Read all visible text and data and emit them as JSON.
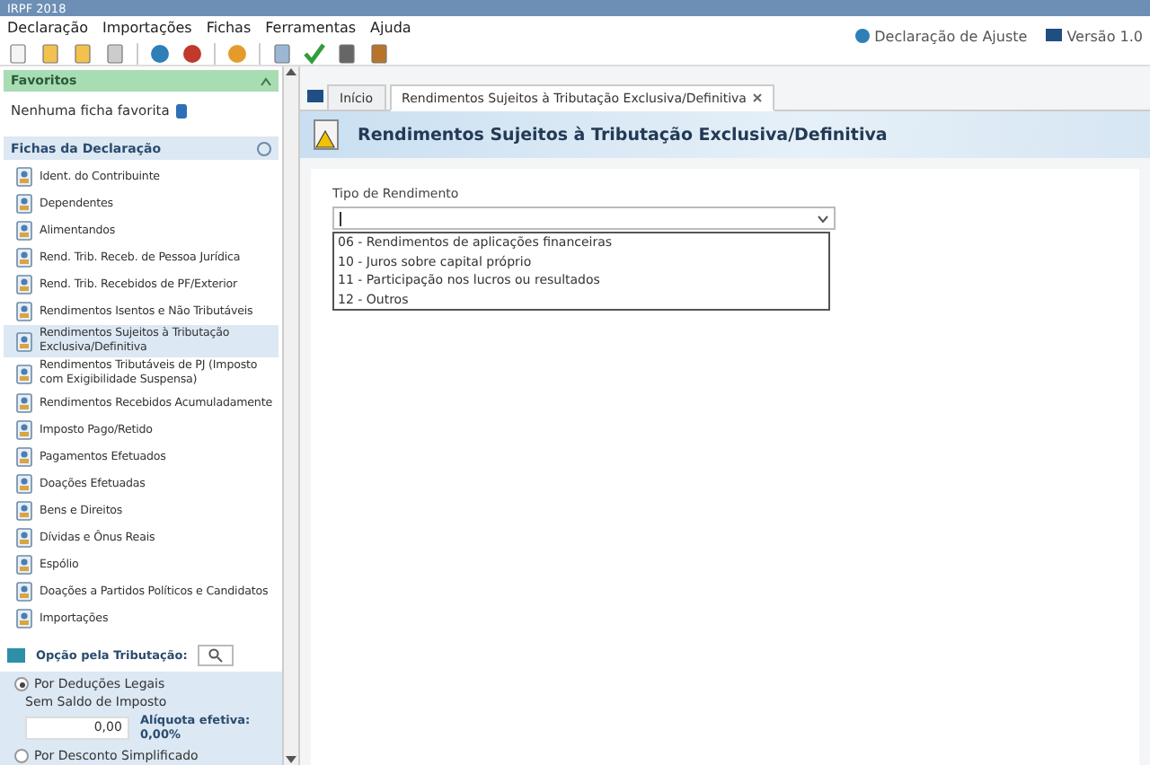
{
  "window": {
    "title": "IRPF 2018"
  },
  "menu": [
    "Declaração",
    "Importações",
    "Fichas",
    "Ferramentas",
    "Ajuda"
  ],
  "status": {
    "declaration": "Declaração de Ajuste",
    "version": "Versão 1.0"
  },
  "favorites": {
    "title": "Favoritos",
    "empty": "Nenhuma ficha favorita"
  },
  "sidebar": {
    "title": "Fichas da Declaração",
    "items": [
      {
        "label": "Ident. do Contribuinte",
        "selected": false
      },
      {
        "label": "Dependentes",
        "selected": false
      },
      {
        "label": "Alimentandos",
        "selected": false
      },
      {
        "label": "Rend. Trib. Receb. de Pessoa Jurídica",
        "selected": false
      },
      {
        "label": "Rend. Trib. Recebidos de PF/Exterior",
        "selected": false
      },
      {
        "label": "Rendimentos Isentos e Não Tributáveis",
        "selected": false
      },
      {
        "label": "Rendimentos Sujeitos à Tributação Exclusiva/Definitiva",
        "selected": true
      },
      {
        "label": "Rendimentos Tributáveis de PJ (Imposto com Exigibilidade Suspensa)",
        "selected": false
      },
      {
        "label": "Rendimentos Recebidos Acumuladamente",
        "selected": false
      },
      {
        "label": "Imposto Pago/Retido",
        "selected": false
      },
      {
        "label": "Pagamentos Efetuados",
        "selected": false
      },
      {
        "label": "Doações Efetuadas",
        "selected": false
      },
      {
        "label": "Bens e Direitos",
        "selected": false
      },
      {
        "label": "Dívidas e Ônus Reais",
        "selected": false
      },
      {
        "label": "Espólio",
        "selected": false
      },
      {
        "label": "Doações a Partidos Políticos e Candidatos",
        "selected": false
      },
      {
        "label": "Importações",
        "selected": false
      }
    ]
  },
  "taxation": {
    "title": "Opção pela Tributação:",
    "options": [
      {
        "label": "Por Deduções Legais",
        "selected": true,
        "balance_label": "Sem Saldo de Imposto",
        "value": "0,00",
        "rate": "Alíquota efetiva: 0,00%"
      },
      {
        "label": "Por Desconto Simplificado",
        "selected": false
      }
    ]
  },
  "tabs": [
    {
      "label": "Início",
      "selected": false,
      "closable": false
    },
    {
      "label": "Rendimentos Sujeitos à Tributação Exclusiva/Definitiva",
      "selected": true,
      "closable": true
    }
  ],
  "page_title": "Rendimentos Sujeitos à Tributação Exclusiva/Definitiva",
  "form": {
    "label": "Tipo de Rendimento",
    "options": [
      "06 - Rendimentos de aplicações financeiras",
      "10 - Juros sobre capital próprio",
      "11 - Participação nos lucros ou resultados",
      "12 - Outros"
    ]
  }
}
